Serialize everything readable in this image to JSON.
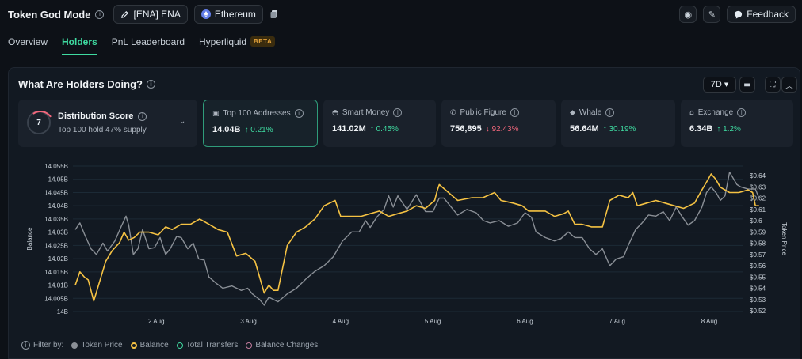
{
  "header": {
    "title": "Token God Mode",
    "token_label": "[ENA] ENA",
    "chain_label": "Ethereum",
    "feedback_label": "Feedback"
  },
  "tabs": [
    {
      "label": "Overview",
      "active": false
    },
    {
      "label": "Holders",
      "active": true
    },
    {
      "label": "PnL Leaderboard",
      "active": false
    },
    {
      "label": "Hyperliquid",
      "badge": "BETA",
      "active": false
    }
  ],
  "panel": {
    "title": "What Are Holders Doing?",
    "range": "7D"
  },
  "cards": {
    "distribution": {
      "score": "7",
      "title": "Distribution Score",
      "subtitle": "Top 100 hold 47% supply"
    },
    "top100": {
      "title": "Top 100 Addresses",
      "value": "14.04B",
      "change": "↑ 0.21%"
    },
    "smart_money": {
      "title": "Smart Money",
      "value": "141.02M",
      "change": "↑ 0.45%"
    },
    "public_figure": {
      "title": "Public Figure",
      "value": "756,895",
      "change": "↓ 92.43%"
    },
    "whale": {
      "title": "Whale",
      "value": "56.64M",
      "change": "↑ 30.19%"
    },
    "exchange": {
      "title": "Exchange",
      "value": "6.34B",
      "change": "↑ 1.2%"
    }
  },
  "chart_data": {
    "type": "line",
    "ylabel": "Balance",
    "y2label": "Token Price",
    "ylim": [
      14.0,
      14.055
    ],
    "y2lim": [
      0.52,
      0.645
    ],
    "y_ticks": [
      "14.055B",
      "14.05B",
      "14.045B",
      "14.04B",
      "14.035B",
      "14.03B",
      "14.025B",
      "14.02B",
      "14.015B",
      "14.01B",
      "14.005B",
      "14B"
    ],
    "y2_ticks": [
      "$0.64",
      "$0.63",
      "$0.62",
      "$0.61",
      "$0.6",
      "$0.59",
      "$0.58",
      "$0.57",
      "$0.56",
      "$0.55",
      "$0.54",
      "$0.53",
      "$0.52"
    ],
    "x_ticks": [
      {
        "label": "2 Aug",
        "x": 1
      },
      {
        "label": "3 Aug",
        "x": 2
      },
      {
        "label": "4 Aug",
        "x": 3
      },
      {
        "label": "5 Aug",
        "x": 4
      },
      {
        "label": "6 Aug",
        "x": 5
      },
      {
        "label": "7 Aug",
        "x": 6
      },
      {
        "label": "8 Aug",
        "x": 7
      }
    ],
    "grid": true,
    "series": [
      {
        "name": "Balance",
        "color": "#f5c243",
        "axis": "left",
        "points": [
          [
            0,
            14.01
          ],
          [
            0.05,
            14.015
          ],
          [
            0.1,
            14.013
          ],
          [
            0.14,
            14.012
          ],
          [
            0.2,
            14.004
          ],
          [
            0.27,
            14.012
          ],
          [
            0.33,
            14.019
          ],
          [
            0.4,
            14.023
          ],
          [
            0.48,
            14.026
          ],
          [
            0.53,
            14.03
          ],
          [
            0.58,
            14.027
          ],
          [
            0.64,
            14.028
          ],
          [
            0.7,
            14.03
          ],
          [
            0.8,
            14.03
          ],
          [
            0.9,
            14.029
          ],
          [
            0.98,
            14.032
          ],
          [
            1.05,
            14.031
          ],
          [
            1.15,
            14.033
          ],
          [
            1.25,
            14.033
          ],
          [
            1.35,
            14.035
          ],
          [
            1.45,
            14.033
          ],
          [
            1.55,
            14.031
          ],
          [
            1.65,
            14.03
          ],
          [
            1.75,
            14.021
          ],
          [
            1.85,
            14.022
          ],
          [
            1.95,
            14.019
          ],
          [
            2.05,
            14.007
          ],
          [
            2.1,
            14.01
          ],
          [
            2.15,
            14.008
          ],
          [
            2.2,
            14.008
          ],
          [
            2.3,
            14.025
          ],
          [
            2.4,
            14.03
          ],
          [
            2.5,
            14.032
          ],
          [
            2.6,
            14.035
          ],
          [
            2.7,
            14.04
          ],
          [
            2.82,
            14.042
          ],
          [
            2.88,
            14.036
          ],
          [
            3.0,
            14.036
          ],
          [
            3.1,
            14.036
          ],
          [
            3.2,
            14.037
          ],
          [
            3.3,
            14.038
          ],
          [
            3.4,
            14.036
          ],
          [
            3.5,
            14.037
          ],
          [
            3.6,
            14.038
          ],
          [
            3.7,
            14.04
          ],
          [
            3.8,
            14.039
          ],
          [
            3.9,
            14.042
          ],
          [
            3.93,
            14.046
          ],
          [
            3.95,
            14.048
          ],
          [
            4.05,
            14.045
          ],
          [
            4.15,
            14.042
          ],
          [
            4.3,
            14.043
          ],
          [
            4.42,
            14.043
          ],
          [
            4.55,
            14.045
          ],
          [
            4.62,
            14.042
          ],
          [
            4.75,
            14.041
          ],
          [
            4.85,
            14.04
          ],
          [
            4.92,
            14.038
          ],
          [
            5.0,
            14.038
          ],
          [
            5.1,
            14.038
          ],
          [
            5.2,
            14.036
          ],
          [
            5.3,
            14.037
          ],
          [
            5.35,
            14.038
          ],
          [
            5.42,
            14.033
          ],
          [
            5.5,
            14.033
          ],
          [
            5.6,
            14.032
          ],
          [
            5.72,
            14.032
          ],
          [
            5.8,
            14.042
          ],
          [
            5.9,
            14.044
          ],
          [
            6.0,
            14.043
          ],
          [
            6.05,
            14.045
          ],
          [
            6.1,
            14.04
          ],
          [
            6.2,
            14.041
          ],
          [
            6.3,
            14.042
          ],
          [
            6.4,
            14.041
          ],
          [
            6.5,
            14.04
          ],
          [
            6.6,
            14.039
          ],
          [
            6.72,
            14.041
          ],
          [
            6.8,
            14.046
          ],
          [
            6.85,
            14.049
          ],
          [
            6.9,
            14.052
          ],
          [
            6.95,
            14.05
          ],
          [
            7.0,
            14.047
          ],
          [
            7.1,
            14.045
          ],
          [
            7.2,
            14.045
          ],
          [
            7.3,
            14.046
          ],
          [
            7.35,
            14.045
          ],
          [
            7.38,
            14.04
          ],
          [
            7.42,
            14.04
          ]
        ]
      },
      {
        "name": "Token Price",
        "color": "#8a8f96",
        "axis": "right",
        "points": [
          [
            0,
            0.592
          ],
          [
            0.05,
            0.598
          ],
          [
            0.1,
            0.588
          ],
          [
            0.17,
            0.575
          ],
          [
            0.23,
            0.57
          ],
          [
            0.3,
            0.58
          ],
          [
            0.35,
            0.573
          ],
          [
            0.43,
            0.582
          ],
          [
            0.5,
            0.595
          ],
          [
            0.55,
            0.604
          ],
          [
            0.58,
            0.596
          ],
          [
            0.63,
            0.57
          ],
          [
            0.68,
            0.575
          ],
          [
            0.73,
            0.592
          ],
          [
            0.8,
            0.575
          ],
          [
            0.86,
            0.576
          ],
          [
            0.92,
            0.585
          ],
          [
            0.98,
            0.57
          ],
          [
            1.03,
            0.575
          ],
          [
            1.1,
            0.586
          ],
          [
            1.15,
            0.585
          ],
          [
            1.22,
            0.575
          ],
          [
            1.28,
            0.58
          ],
          [
            1.34,
            0.566
          ],
          [
            1.4,
            0.565
          ],
          [
            1.45,
            0.55
          ],
          [
            1.52,
            0.545
          ],
          [
            1.6,
            0.54
          ],
          [
            1.7,
            0.542
          ],
          [
            1.8,
            0.538
          ],
          [
            1.87,
            0.54
          ],
          [
            1.92,
            0.535
          ],
          [
            2.0,
            0.53
          ],
          [
            2.05,
            0.525
          ],
          [
            2.1,
            0.532
          ],
          [
            2.2,
            0.528
          ],
          [
            2.3,
            0.535
          ],
          [
            2.4,
            0.54
          ],
          [
            2.5,
            0.548
          ],
          [
            2.6,
            0.555
          ],
          [
            2.7,
            0.56
          ],
          [
            2.8,
            0.568
          ],
          [
            2.9,
            0.582
          ],
          [
            3.0,
            0.59
          ],
          [
            3.08,
            0.59
          ],
          [
            3.15,
            0.6
          ],
          [
            3.2,
            0.594
          ],
          [
            3.27,
            0.603
          ],
          [
            3.35,
            0.61
          ],
          [
            3.4,
            0.622
          ],
          [
            3.45,
            0.612
          ],
          [
            3.5,
            0.622
          ],
          [
            3.6,
            0.61
          ],
          [
            3.7,
            0.623
          ],
          [
            3.8,
            0.608
          ],
          [
            3.88,
            0.608
          ],
          [
            3.95,
            0.62
          ],
          [
            4.0,
            0.62
          ],
          [
            4.08,
            0.612
          ],
          [
            4.15,
            0.605
          ],
          [
            4.25,
            0.61
          ],
          [
            4.35,
            0.607
          ],
          [
            4.43,
            0.6
          ],
          [
            4.5,
            0.598
          ],
          [
            4.6,
            0.6
          ],
          [
            4.7,
            0.595
          ],
          [
            4.8,
            0.598
          ],
          [
            4.88,
            0.607
          ],
          [
            4.95,
            0.603
          ],
          [
            5.0,
            0.59
          ],
          [
            5.1,
            0.585
          ],
          [
            5.2,
            0.582
          ],
          [
            5.27,
            0.584
          ],
          [
            5.35,
            0.59
          ],
          [
            5.42,
            0.585
          ],
          [
            5.5,
            0.585
          ],
          [
            5.58,
            0.575
          ],
          [
            5.65,
            0.57
          ],
          [
            5.72,
            0.575
          ],
          [
            5.8,
            0.56
          ],
          [
            5.87,
            0.566
          ],
          [
            5.95,
            0.568
          ],
          [
            6.0,
            0.578
          ],
          [
            6.08,
            0.592
          ],
          [
            6.15,
            0.598
          ],
          [
            6.22,
            0.605
          ],
          [
            6.3,
            0.604
          ],
          [
            6.38,
            0.608
          ],
          [
            6.45,
            0.6
          ],
          [
            6.52,
            0.612
          ],
          [
            6.58,
            0.604
          ],
          [
            6.65,
            0.596
          ],
          [
            6.72,
            0.6
          ],
          [
            6.8,
            0.612
          ],
          [
            6.85,
            0.625
          ],
          [
            6.9,
            0.63
          ],
          [
            6.96,
            0.624
          ],
          [
            7.0,
            0.618
          ],
          [
            7.05,
            0.622
          ],
          [
            7.1,
            0.643
          ],
          [
            7.18,
            0.632
          ],
          [
            7.22,
            0.63
          ],
          [
            7.3,
            0.628
          ],
          [
            7.38,
            0.628
          ],
          [
            7.42,
            0.62
          ]
        ]
      }
    ]
  },
  "legend": {
    "filter_label": "Filter by:",
    "items": [
      {
        "label": "Token Price",
        "color": "#8a8f96",
        "filled": true
      },
      {
        "label": "Balance",
        "color": "#f5c243",
        "filled": false
      },
      {
        "label": "Total Transfers",
        "color": "#3fdba1",
        "filled": false
      },
      {
        "label": "Balance Changes",
        "color": "#c27b9c",
        "filled": false
      }
    ]
  }
}
